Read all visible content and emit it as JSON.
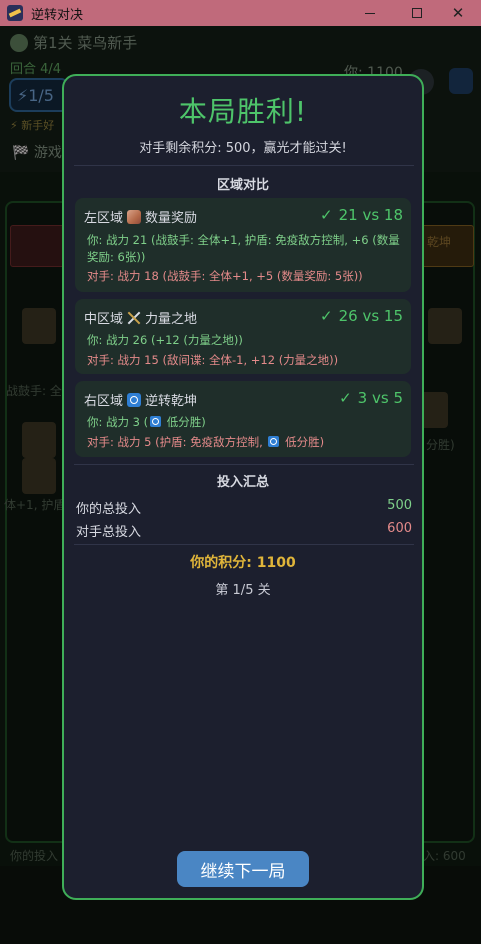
{
  "window": {
    "title": "逆转对决",
    "min_icon": "minimize-icon",
    "max_icon": "maximize-icon",
    "close_icon": "close-icon"
  },
  "background_game": {
    "level_title": "第1关 菜鸟新手",
    "round": "回合 4/4",
    "score": "你: 1100",
    "energy": "1/5",
    "tip": "新手好",
    "game_label": "游戏",
    "right_zone_label": "乾坤",
    "drummer_text": "战鼓手: 全",
    "buff_text": "体+1, 护盾",
    "low_win_text": "分胜)",
    "your_invest_bottom": "你的投入",
    "opp_invest_bottom": "入: 600"
  },
  "modal": {
    "title": "本局胜利!",
    "subtitle": "对手剩余积分: 500，赢光才能过关!",
    "compare_title": "区域对比",
    "zones": [
      {
        "name": "左区域",
        "icon": "crate-icon",
        "effect": "数量奖励",
        "result": "21 vs 18",
        "you": "你: 战力 21 (战鼓手: 全体+1, 护盾: 免疫敌方控制, +6 (数量奖励: 6张))",
        "opp": "对手: 战力 18 (战鼓手: 全体+1, +5 (数量奖励: 5张))"
      },
      {
        "name": "中区域",
        "icon": "swords-icon",
        "effect": "力量之地",
        "result": "26 vs 15",
        "you": "你: 战力 26 (+12 (力量之地))",
        "opp": "对手: 战力 15 (敌间谍: 全体-1, +12 (力量之地))"
      },
      {
        "name": "右区域",
        "icon": "swap-icon",
        "effect": "逆转乾坤",
        "result": "3 vs 5",
        "you_prefix": "你: 战力 3 (",
        "you_suffix": " 低分胜)",
        "opp_prefix": "对手: 战力 5 (护盾: 免疫敌方控制, ",
        "opp_suffix": " 低分胜)"
      }
    ],
    "summary_title": "投入汇总",
    "your_total_label": "你的总投入",
    "your_total_value": "500",
    "opp_total_label": "对手总投入",
    "opp_total_value": "600",
    "points": "你的积分: 1100",
    "progress": "第 1/5 关",
    "continue_label": "继续下一局"
  },
  "colors": {
    "win_green": "#4ec46a",
    "opp_red": "#e48a8a",
    "gold": "#e0b53a",
    "button_blue": "#4a86c4",
    "title_bar": "#c06a7b"
  }
}
